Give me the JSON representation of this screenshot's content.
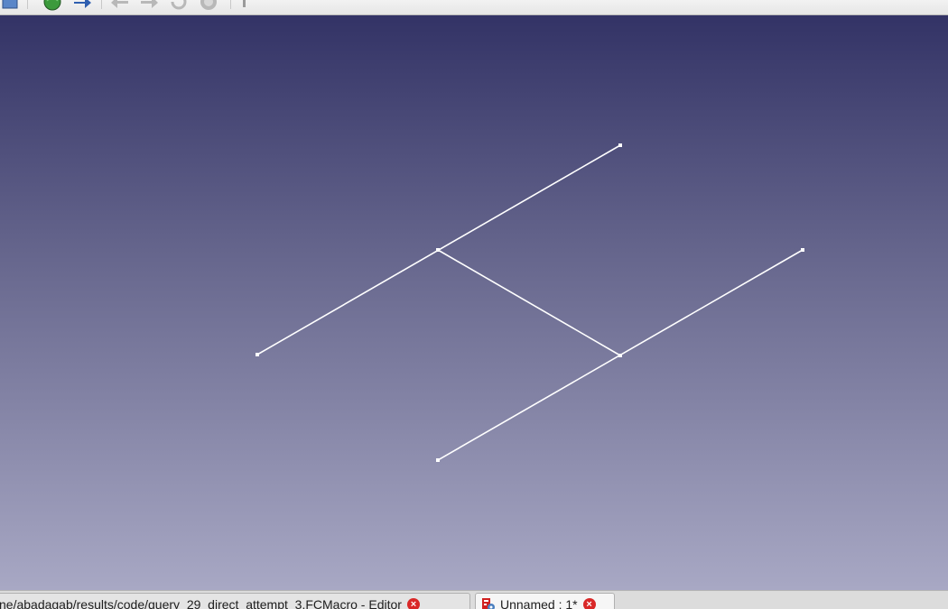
{
  "toolbar": {
    "icons": [
      "box-icon",
      "globe-icon",
      "arrow-right-icon",
      "back-icon",
      "forward-icon",
      "refresh-icon",
      "stop-icon",
      "pointer-icon"
    ]
  },
  "viewport": {
    "background_top": "#333366",
    "background_bottom": "#a8a8c4",
    "line_color": "#ffffff"
  },
  "tabs": [
    {
      "label": "ne/abadagab/results/code/query_29_direct_attempt_3.FCMacro - Editor",
      "close": "×"
    },
    {
      "label": "Unnamed : 1*",
      "close": "×"
    }
  ]
}
